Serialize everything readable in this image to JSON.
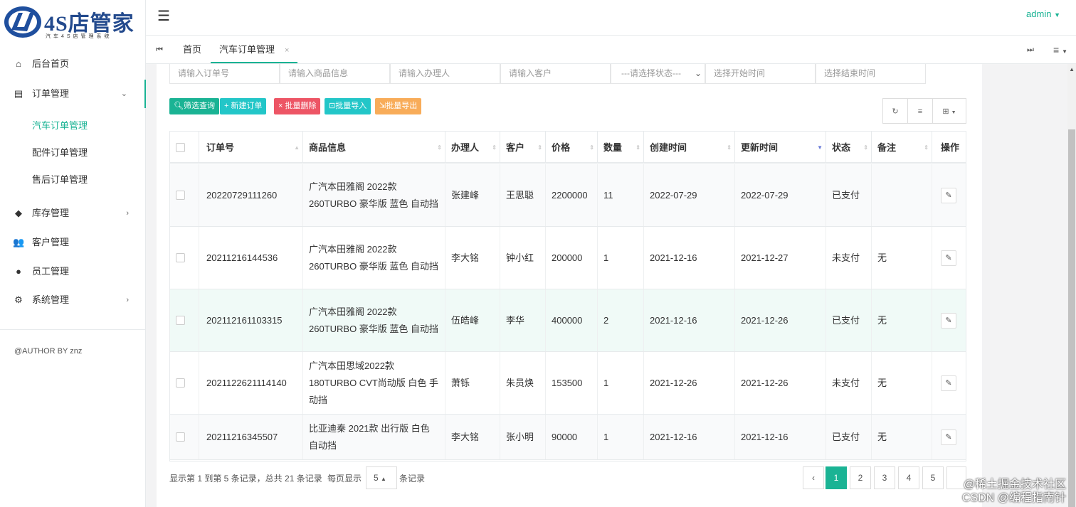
{
  "brand": {
    "title": "4S店管家",
    "subtitle": "汽车4S店管理系统",
    "accent": "#1ab394"
  },
  "sidebar": {
    "items": [
      {
        "label": "后台首页",
        "icon": "home-icon"
      },
      {
        "label": "订单管理",
        "icon": "clipboard-icon",
        "expanded": true,
        "children": [
          {
            "label": "汽车订单管理",
            "active": true
          },
          {
            "label": "配件订单管理"
          },
          {
            "label": "售后订单管理"
          }
        ]
      },
      {
        "label": "库存管理",
        "icon": "cube-icon"
      },
      {
        "label": "客户管理",
        "icon": "users-icon"
      },
      {
        "label": "员工管理",
        "icon": "user-icon"
      },
      {
        "label": "系统管理",
        "icon": "gear-icon"
      }
    ],
    "author": "@AUTHOR BY znz"
  },
  "header": {
    "user": "admin"
  },
  "tabs": [
    {
      "label": "首页"
    },
    {
      "label": "汽车订单管理",
      "closable": true
    }
  ],
  "filters": {
    "order_no": "请输入订单号",
    "product": "请输入商品信息",
    "handler": "请输入办理人",
    "customer": "请输入客户",
    "status": "---请选择状态---",
    "start": "选择开始时间",
    "end": "选择结束时间"
  },
  "toolbar": {
    "query": "筛选查询",
    "new": "新建订单",
    "delete": "批量删除",
    "import": "批量导入",
    "export": "批量导出"
  },
  "table": {
    "columns": [
      "订单号",
      "商品信息",
      "办理人",
      "客户",
      "价格",
      "数量",
      "创建时间",
      "更新时间",
      "状态",
      "备注",
      "操作"
    ],
    "rows": [
      {
        "order": "20220729111260",
        "product": "广汽本田雅阁 2022款 260TURBO 豪华版 蓝色 自动挡",
        "handler": "张建峰",
        "customer": "王思聪",
        "price": "2200000",
        "qty": "11",
        "created": "2022-07-29",
        "updated": "2022-07-29",
        "status": "已支付",
        "note": ""
      },
      {
        "order": "20211216144536",
        "product": "广汽本田雅阁 2022款 260TURBO 豪华版 蓝色 自动挡",
        "handler": "李大铭",
        "customer": "钟小红",
        "price": "200000",
        "qty": "1",
        "created": "2021-12-16",
        "updated": "2021-12-27",
        "status": "未支付",
        "note": "无"
      },
      {
        "order": "20211216110331​5",
        "product": "广汽本田雅阁 2022款 260TURBO 豪华版 蓝色 自动挡",
        "handler": "伍皓峰",
        "customer": "李华",
        "price": "400000",
        "qty": "2",
        "created": "2021-12-16",
        "updated": "2021-12-26",
        "status": "已支付",
        "note": "无"
      },
      {
        "order": "20211226211141​40",
        "product": "广汽本田思域2022款 180TURBO CVT尚动版 白色 手动挡",
        "handler": "萧铄",
        "customer": "朱员焕",
        "price": "153500",
        "qty": "1",
        "created": "2021-12-26",
        "updated": "2021-12-26",
        "status": "未支付",
        "note": "无"
      },
      {
        "order": "20211216345507",
        "product": "比亚迪秦 2021款 出行版 白色 自动挡",
        "handler": "李大铭",
        "customer": "张小明",
        "price": "90000",
        "qty": "1",
        "created": "2021-12-16",
        "updated": "2021-12-16",
        "status": "已支付",
        "note": "无"
      }
    ]
  },
  "pagination": {
    "summary_a": "显示第 1 到第 5 条记录，总共 21 条记录",
    "summary_b": "每页显示",
    "page_size": "5",
    "summary_c": "条记录",
    "prev": "‹",
    "pages": [
      "1",
      "2",
      "3",
      "4",
      "5"
    ],
    "current": "1"
  },
  "watermark": {
    "line1": "@稀土掘金技术社区",
    "line2": "CSDN @编程指南针"
  }
}
